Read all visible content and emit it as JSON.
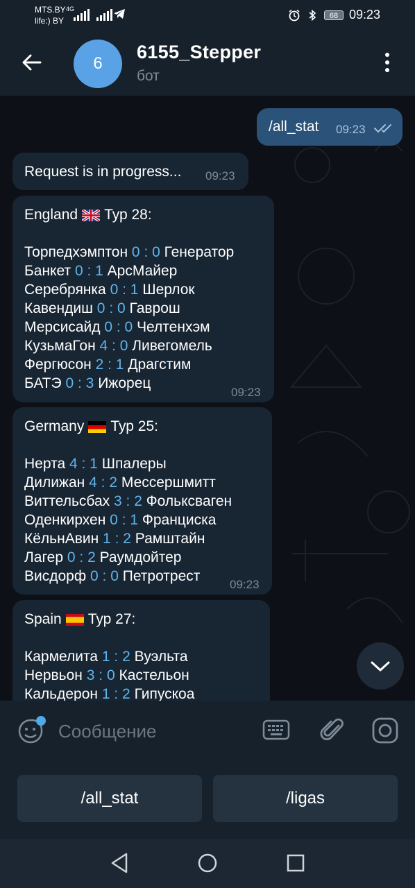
{
  "status_bar": {
    "carrier1": "MTS.BY",
    "carrier2": "life:) BY",
    "network": "4G",
    "battery": "68",
    "time": "09:23"
  },
  "header": {
    "avatar_letter": "6",
    "title": "6155_Stepper",
    "subtitle": "бот"
  },
  "messages": {
    "outgoing": {
      "text": "/all_stat",
      "time": "09:23"
    },
    "progress": {
      "text": "Request is in progress...",
      "time": "09:23"
    },
    "england": {
      "country": "England",
      "round": "Тур 28:",
      "time": "09:23",
      "matches": [
        {
          "home": "Торпедхэмптон",
          "hs": "0",
          "as": "0",
          "away": "Генератор"
        },
        {
          "home": "Банкет",
          "hs": "0",
          "as": "1",
          "away": "АрсМайер"
        },
        {
          "home": "Серебрянка",
          "hs": "0",
          "as": "1",
          "away": "Шерлок"
        },
        {
          "home": "Кавендиш",
          "hs": "0",
          "as": "0",
          "away": "Гаврош"
        },
        {
          "home": "Мерсисайд",
          "hs": "0",
          "as": "0",
          "away": "Челтенхэм"
        },
        {
          "home": "КузьмаГон",
          "hs": "4",
          "as": "0",
          "away": "Ливегомель"
        },
        {
          "home": "Фергюсон",
          "hs": "2",
          "as": "1",
          "away": "Драгстим"
        },
        {
          "home": "БАТЭ",
          "hs": "0",
          "as": "3",
          "away": "Ижорец"
        }
      ]
    },
    "germany": {
      "country": "Germany",
      "round": "Тур 25:",
      "time": "09:23",
      "matches": [
        {
          "home": "Нерта",
          "hs": "4",
          "as": "1",
          "away": "Шпалеры"
        },
        {
          "home": "Дилижан",
          "hs": "4",
          "as": "2",
          "away": "Мессершмитт"
        },
        {
          "home": "Виттельсбах",
          "hs": "3",
          "as": "2",
          "away": "Фольксваген"
        },
        {
          "home": "Оденкирхен",
          "hs": "0",
          "as": "1",
          "away": "Франциска"
        },
        {
          "home": "КёльнАвин",
          "hs": "1",
          "as": "2",
          "away": "Рамштайн"
        },
        {
          "home": "Лагер",
          "hs": "0",
          "as": "2",
          "away": "Раумдойтер"
        },
        {
          "home": "Висдорф",
          "hs": "0",
          "as": "0",
          "away": "Петротрест"
        }
      ]
    },
    "spain": {
      "country": "Spain",
      "round": "Тур 27:",
      "matches": [
        {
          "home": "Кармелита",
          "hs": "1",
          "as": "2",
          "away": "Вуэльта"
        },
        {
          "home": "Нервьон",
          "hs": "3",
          "as": "0",
          "away": "Кастельон"
        },
        {
          "home": "Кальдерон",
          "hs": "1",
          "as": "2",
          "away": "Гипускоа"
        }
      ]
    }
  },
  "composer": {
    "placeholder": "Сообщение"
  },
  "bot_keyboard": {
    "keys": [
      "/all_stat",
      "/ligas"
    ]
  },
  "icons": {
    "back": "arrow-left-icon",
    "menu": "more-vertical-icon",
    "scroll": "chevron-down-icon",
    "emoji": "sticker-emoji-icon",
    "keyboard": "keyboard-icon",
    "attach": "paperclip-icon",
    "camera": "instagram-camera-icon"
  },
  "colors": {
    "accent": "#5fb5ec",
    "outgoing_bubble": "#2b5278",
    "incoming_bubble": "#182533",
    "header": "#17212b"
  }
}
